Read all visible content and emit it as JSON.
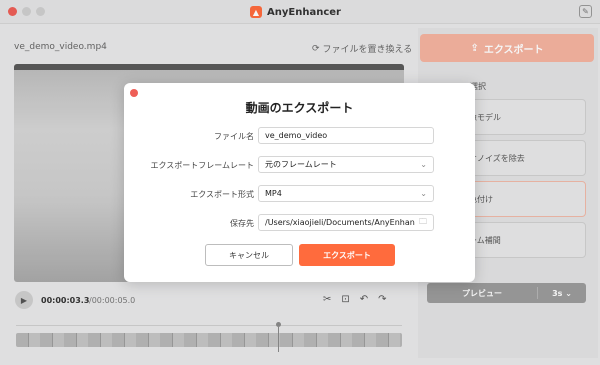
{
  "app": {
    "title": "AnyEnhancer"
  },
  "editor": {
    "filename": "ve_demo_video.mp4",
    "replace_label": "ファイルを置き換える",
    "time_current": "00:00:03.3",
    "time_total": "/00:00:05.0"
  },
  "right_panel": {
    "export_label": "エクスポート",
    "section_label": "選択",
    "options": [
      "像モデル",
      "オノイズを除去",
      "色付け",
      "ーム補間"
    ],
    "preview_label": "プレビュー",
    "preview_duration": "3s"
  },
  "modal": {
    "title": "動画のエクスポート",
    "filename_label": "ファイル名",
    "filename_value": "ve_demo_video",
    "framerate_label": "エクスポートフレームレート",
    "framerate_value": "元のフレームレート",
    "format_label": "エクスポート形式",
    "format_value": "MP4",
    "path_label": "保存先",
    "path_value": "/Users/xiaojieli/Documents/AnyEnhancer",
    "cancel_label": "キャンセル",
    "export_label": "エクスポート"
  },
  "colors": {
    "accent": "#ff6b3d",
    "accent_light": "#f5b3a0"
  }
}
